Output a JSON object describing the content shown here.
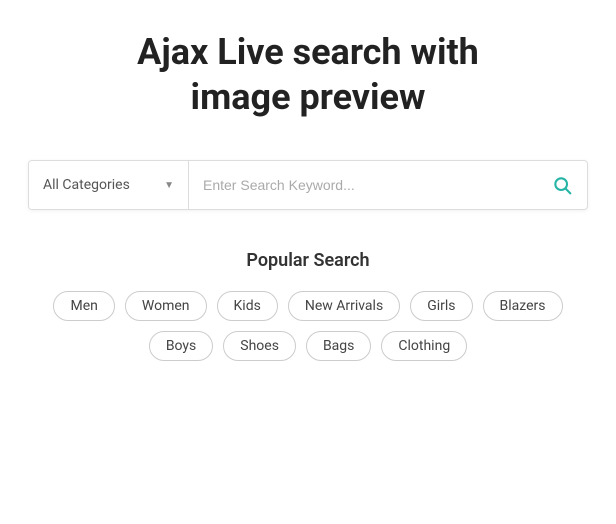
{
  "header": {
    "title": "Ajax Live search with image preview"
  },
  "search": {
    "category_label": "All Categories",
    "placeholder": "Enter Search Keyword..."
  },
  "popular": {
    "section_title": "Popular Search",
    "tags": [
      {
        "label": "Men"
      },
      {
        "label": "Women"
      },
      {
        "label": "Kids"
      },
      {
        "label": "New Arrivals"
      },
      {
        "label": "Girls"
      },
      {
        "label": "Blazers"
      },
      {
        "label": "Boys"
      },
      {
        "label": "Shoes"
      },
      {
        "label": "Bags"
      },
      {
        "label": "Clothing"
      }
    ]
  }
}
